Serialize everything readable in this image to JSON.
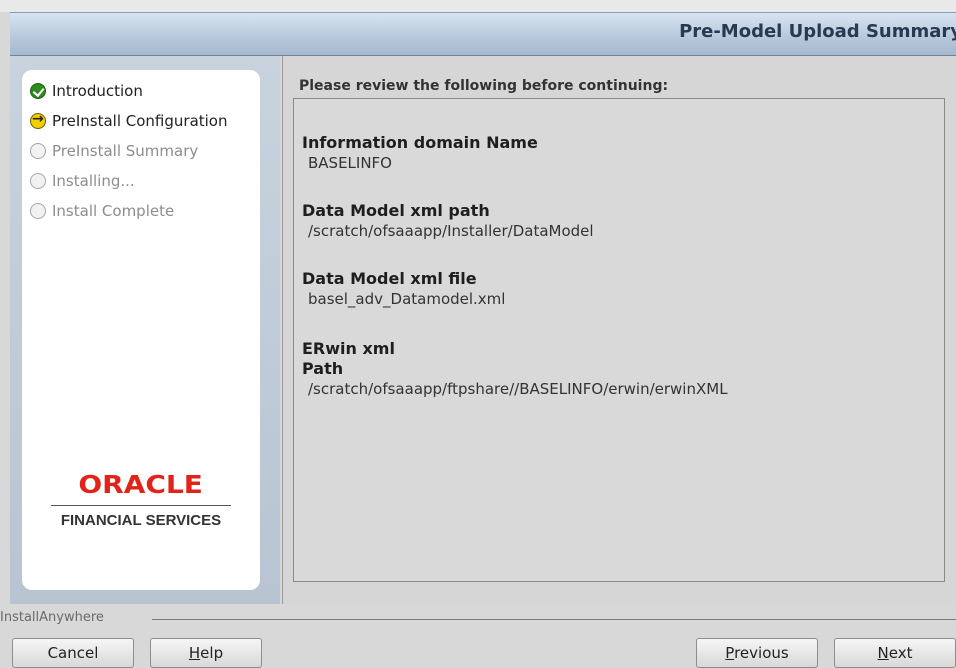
{
  "header": {
    "title": "Pre-Model Upload Summary"
  },
  "sidebar": {
    "steps": [
      {
        "label": "Introduction",
        "state": "done",
        "icon": "check-icon"
      },
      {
        "label": "PreInstall Configuration",
        "state": "current",
        "icon": "arrow-right-icon"
      },
      {
        "label": "PreInstall Summary",
        "state": "todo",
        "icon": "circle-icon"
      },
      {
        "label": "Installing...",
        "state": "todo",
        "icon": "circle-icon"
      },
      {
        "label": "Install Complete",
        "state": "todo",
        "icon": "circle-icon"
      }
    ],
    "logo": {
      "brand": "ORACLE",
      "subtitle": "FINANCIAL SERVICES"
    }
  },
  "main": {
    "heading": "Please review the following before continuing:",
    "items": [
      {
        "name": "Information domain Name",
        "value": "BASELINFO"
      },
      {
        "name": "Data Model xml path",
        "value": "/scratch/ofsaaapp/Installer/DataModel"
      },
      {
        "name": "Data Model xml file",
        "value": "basel_adv_Datamodel.xml"
      },
      {
        "name": "ERwin xml\nPath",
        "name_line1": "ERwin xml",
        "name_line2": "Path",
        "value": "/scratch/ofsaaapp/ftpshare//BASELINFO/erwin/erwinXML"
      }
    ]
  },
  "footer": {
    "label": "InstallAnywhere",
    "buttons": {
      "cancel": "Cancel",
      "help_mnemonic": "H",
      "help_rest": "elp",
      "previous_mnemonic": "P",
      "previous_rest": "revious",
      "next_mnemonic": "N",
      "next_rest": "ext"
    }
  },
  "colors": {
    "oracle_red": "#e2231a",
    "header_text": "#273a52",
    "step_done": "#2f8a1f",
    "step_current": "#f0d000"
  }
}
